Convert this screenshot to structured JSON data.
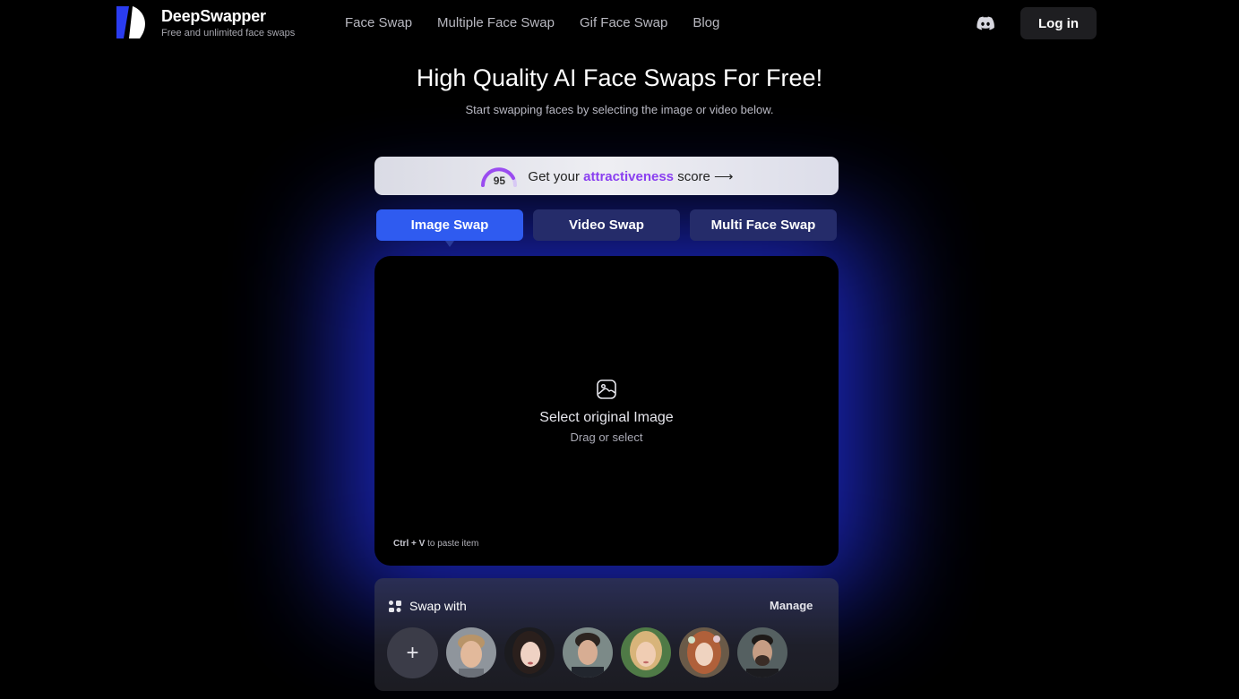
{
  "header": {
    "brand_name": "DeepSwapper",
    "brand_tagline": "Free and unlimited face swaps",
    "nav": [
      "Face Swap",
      "Multiple Face Swap",
      "Gif Face Swap",
      "Blog"
    ],
    "login_label": "Log in"
  },
  "hero": {
    "title": "High Quality AI Face Swaps For Free!",
    "subtitle": "Start swapping faces by selecting the image or video below."
  },
  "banner": {
    "gauge_score": "95",
    "text_before": "Get your ",
    "highlight": "attractiveness",
    "text_after": " score ⟶",
    "highlight_color": "#8a3ff0"
  },
  "tabs": [
    {
      "label": "Image Swap",
      "active": true
    },
    {
      "label": "Video Swap",
      "active": false
    },
    {
      "label": "Multi Face Swap",
      "active": false
    }
  ],
  "dropzone": {
    "icon": "image-icon",
    "title": "Select original Image",
    "subtitle": "Drag or select",
    "paste_keys": "Ctrl + V",
    "paste_text": " to paste item"
  },
  "swap_panel": {
    "label": "Swap with",
    "manage_label": "Manage",
    "add_label": "+"
  },
  "colors": {
    "accent_blue": "#2f5bf0",
    "tab_inactive": "#252c6a",
    "glow": "#1e2bd6"
  }
}
